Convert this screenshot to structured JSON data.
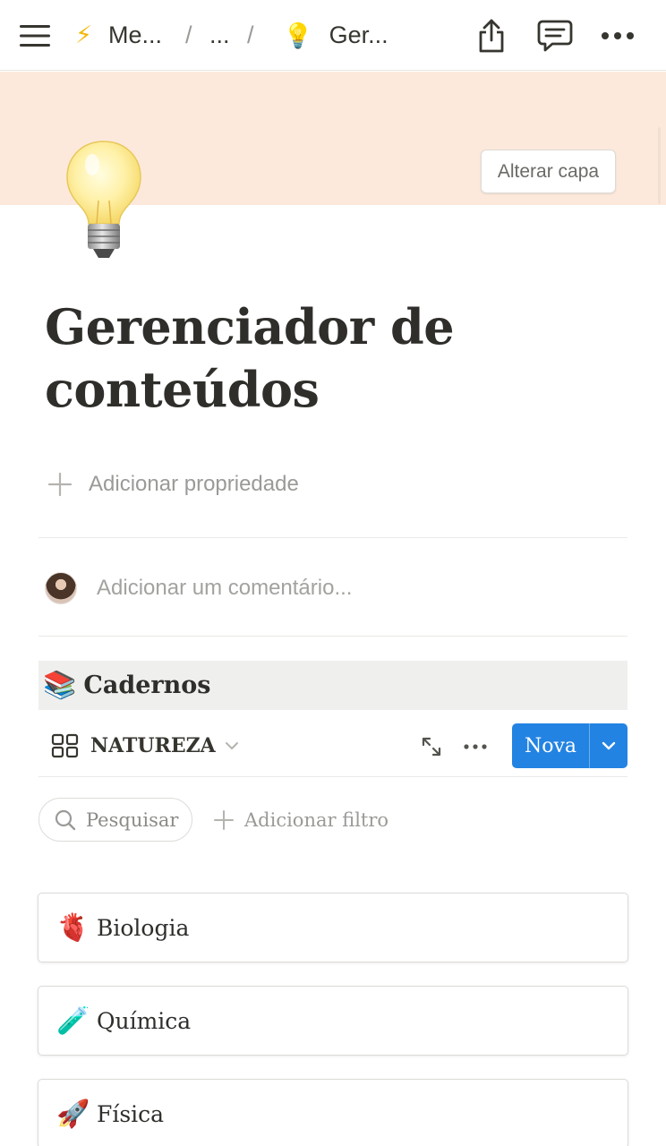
{
  "topbar": {
    "breadcrumbs": [
      {
        "icon": "⚡",
        "label": "Me..."
      },
      {
        "icon": "",
        "label": "..."
      },
      {
        "icon": "💡",
        "label": "Ger..."
      }
    ],
    "separator": "/"
  },
  "cover": {
    "change_label": "Alterar capa",
    "color": "#fde9dc"
  },
  "page": {
    "icon": "lightbulb",
    "title_line1": "Gerenciador de",
    "title_line2": "conteúdos",
    "add_property_label": "Adicionar propriedade",
    "comment_placeholder": "Adicionar um comentário..."
  },
  "database": {
    "icon": "📚",
    "title": "Cadernos",
    "view_name": "NATUREZA",
    "new_button_label": "Nova",
    "accent_color": "#2383e2",
    "search_label": "Pesquisar",
    "add_filter_label": "Adicionar filtro",
    "items": [
      {
        "icon": "🫀",
        "label": "Biologia"
      },
      {
        "icon": "🧪",
        "label": "Química"
      },
      {
        "icon": "🚀",
        "label": "Física"
      }
    ]
  }
}
